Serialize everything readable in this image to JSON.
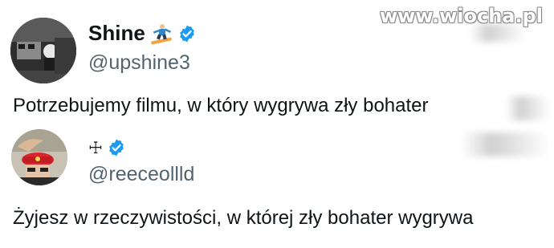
{
  "watermark": "www.wiocha.pl",
  "tweet_author": {
    "name": "Shine",
    "handle": "@upshine3",
    "verified": true,
    "emoji_icon": "snowboarder-icon"
  },
  "tweet": {
    "text": "Potrzebujemy filmu, w który wygrywa zły bohater"
  },
  "reply_author": {
    "name": "☩",
    "handle": "@reeceollld",
    "verified": true
  },
  "reply": {
    "text": "Żyjesz w rzeczywistości, w której zły bohater wygrywa"
  },
  "colors": {
    "verified_badge": "#1d9bf0",
    "text_primary": "#0f1419",
    "text_secondary": "#536471"
  }
}
